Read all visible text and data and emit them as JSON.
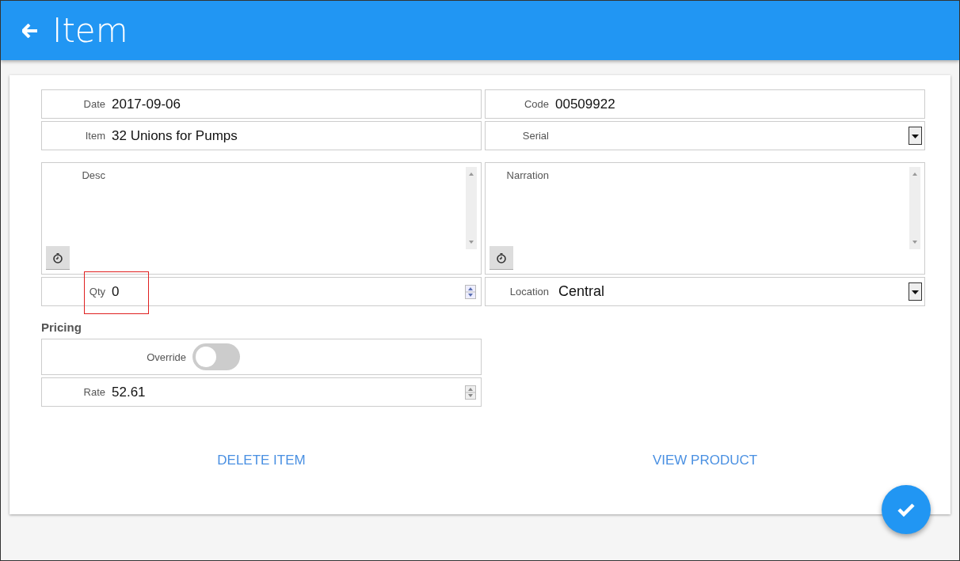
{
  "header": {
    "title": "Item"
  },
  "fields": [
    {
      "label": "Date",
      "value": "2017-09-06",
      "kind": "text"
    },
    {
      "label": "Code",
      "value": "00509922",
      "kind": "text"
    },
    {
      "label": "Item",
      "value": "32 Unions for Pumps",
      "kind": "text"
    },
    {
      "label": "Serial",
      "kind": "select"
    },
    {
      "label": "Desc",
      "kind": "textarea"
    },
    {
      "label": "Narration",
      "kind": "textarea"
    },
    {
      "label": "Qty",
      "value": "0",
      "kind": "number",
      "highlighted": true
    },
    {
      "label": "Location",
      "value": "Central",
      "kind": "select"
    }
  ],
  "pricing": {
    "title": "Pricing",
    "override": {
      "label": "Override",
      "on": false
    },
    "rate": {
      "label": "Rate",
      "value": "52.61"
    }
  },
  "actions": [
    "DELETE ITEM",
    "VIEW PRODUCT"
  ]
}
